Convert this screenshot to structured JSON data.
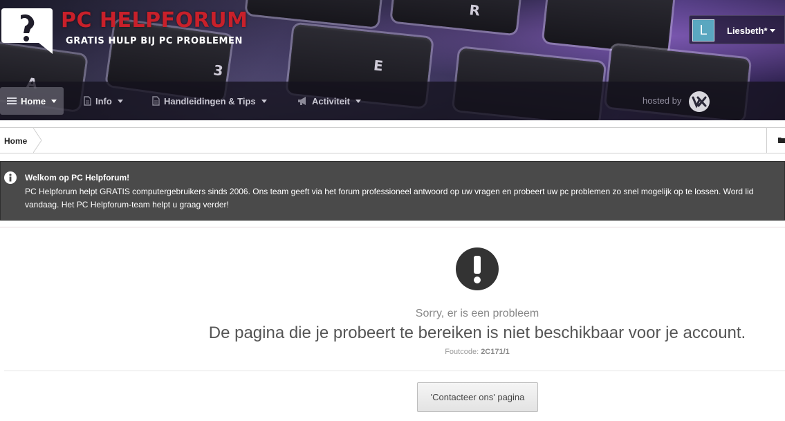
{
  "header": {
    "site_title": "PC HELPFORUM",
    "tagline": "GRATIS HULP BIJ PC PROBLEMEN",
    "user": {
      "avatar_letter": "L",
      "name": "Liesbeth*"
    },
    "keys": [
      "3",
      "E",
      "A",
      "R"
    ]
  },
  "nav": {
    "items": [
      {
        "label": "Home",
        "icon": "list-icon",
        "active": true
      },
      {
        "label": "Info",
        "icon": "document-icon",
        "active": false
      },
      {
        "label": "Handleidingen & Tips",
        "icon": "document-icon",
        "active": false
      },
      {
        "label": "Activiteit",
        "icon": "megaphone-icon",
        "active": false
      }
    ],
    "hosted_by": "hosted by"
  },
  "breadcrumb": {
    "home": "Home"
  },
  "notice": {
    "title": "Welkom op PC Helpforum!",
    "text": "PC Helpforum helpt GRATIS computergebruikers sinds 2006. Ons team geeft via het forum professioneel antwoord op uw vragen en probeert uw pc problemen zo snel mogelijk op te lossen. Word lid vandaag. Het PC Helpforum-team helpt u graag verder!"
  },
  "error": {
    "sorry": "Sorry, er is een probleem",
    "message": "De pagina die je probeert te bereiken is niet beschikbaar voor je account.",
    "code_label": "Foutcode:",
    "code": "2C171/1",
    "button_label": "'Contacteer ons' pagina"
  },
  "colors": {
    "title_red": "#c8202a",
    "nav_bg": "#1a1826",
    "notice_bg": "#4a4a4a",
    "avatar": "#5aa7c0"
  }
}
